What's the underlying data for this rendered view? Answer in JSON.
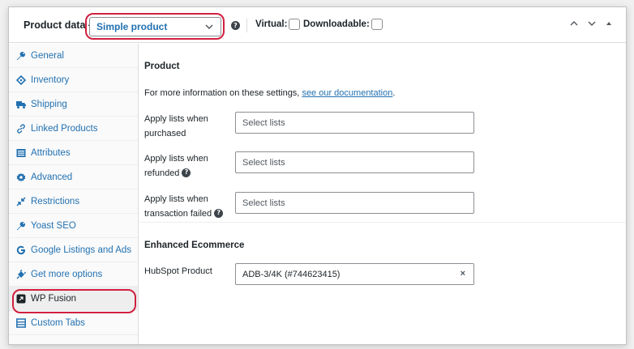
{
  "header": {
    "title": "Product data —",
    "product_type": "Simple product",
    "virtual_label": "Virtual:",
    "downloadable_label": "Downloadable:",
    "help_glyph": "?"
  },
  "sidebar": {
    "items": [
      {
        "label": "General",
        "icon": "wrench-icon"
      },
      {
        "label": "Inventory",
        "icon": "tag-icon"
      },
      {
        "label": "Shipping",
        "icon": "truck-icon"
      },
      {
        "label": "Linked Products",
        "icon": "link-icon"
      },
      {
        "label": "Attributes",
        "icon": "list-icon"
      },
      {
        "label": "Advanced",
        "icon": "gear-icon"
      },
      {
        "label": "Restrictions",
        "icon": "arrows-icon"
      },
      {
        "label": "Yoast SEO",
        "icon": "wrench-icon"
      },
      {
        "label": "Google Listings and Ads",
        "icon": "google-icon"
      },
      {
        "label": "Get more options",
        "icon": "plugin-icon"
      },
      {
        "label": "WP Fusion",
        "icon": "wp-fusion-icon"
      },
      {
        "label": "Custom Tabs",
        "icon": "tabs-icon"
      }
    ],
    "active": "WP Fusion"
  },
  "main": {
    "product_heading": "Product",
    "info_text": "For more information on these settings, ",
    "info_link": "see our documentation",
    "info_end": ".",
    "rows": [
      {
        "label_line1": "Apply lists when",
        "label_line2": "purchased",
        "placeholder": "Select lists"
      },
      {
        "label_line1": "Apply lists when",
        "label_line2": "refunded",
        "placeholder": "Select lists"
      },
      {
        "label_line1": "Apply lists when",
        "label_line2": "transaction failed",
        "placeholder": "Select lists"
      }
    ],
    "ecommerce_heading": "Enhanced Ecommerce",
    "hubspot_label": "HubSpot Product",
    "hubspot_value": "ADB-3/4K (#744623415)",
    "clear_glyph": "×"
  },
  "colors": {
    "accent": "#2271b1",
    "highlight": "#d1203f"
  }
}
